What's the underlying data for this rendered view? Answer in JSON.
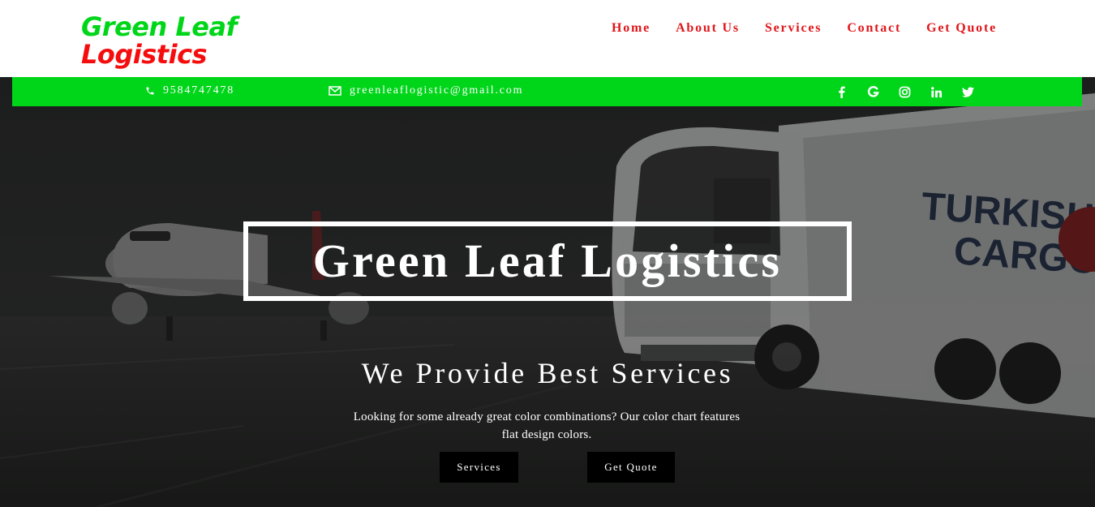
{
  "logo": {
    "line1": "Green Leaf",
    "line2": "Logistics"
  },
  "nav": [
    {
      "label": "Home"
    },
    {
      "label": "About Us"
    },
    {
      "label": "Services"
    },
    {
      "label": "Contact"
    },
    {
      "label": "Get Quote"
    }
  ],
  "infobar": {
    "phone": "9584747478",
    "email": "greenleaflogistic@gmail.com",
    "socials": [
      "facebook-icon",
      "google-icon",
      "instagram-icon",
      "linkedin-icon",
      "twitter-icon"
    ]
  },
  "hero": {
    "title": "Green Leaf Logistics",
    "subtitle": "We Provide Best Services",
    "description": "Looking for some already great color combinations? Our color chart features flat design colors.",
    "buttons": {
      "services": "Services",
      "quote": "Get Quote"
    },
    "truck_lettering": "TURKISH CARGO"
  },
  "colors": {
    "brand_green": "#00d619",
    "brand_red": "#f50d0d",
    "nav_red": "#e0161a",
    "button_bg": "#000000"
  }
}
